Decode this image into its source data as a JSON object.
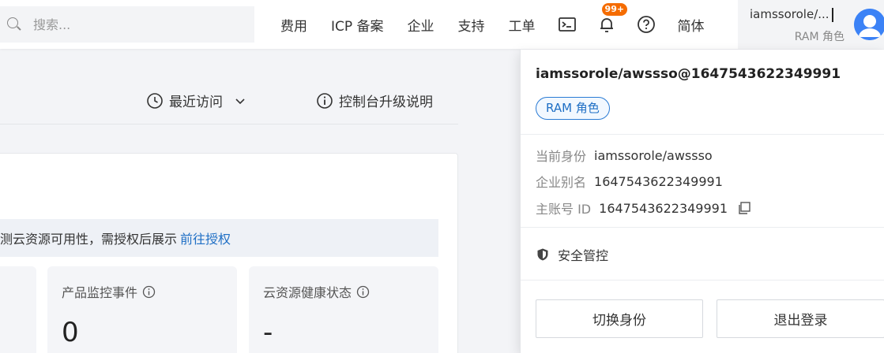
{
  "search": {
    "placeholder": "搜索..."
  },
  "nav": {
    "fees": "费用",
    "icp": "ICP 备案",
    "enterprise": "企业",
    "support": "支持",
    "tickets": "工单",
    "notification_badge": "99+",
    "language": "简体"
  },
  "account": {
    "name": "iamssorole/...",
    "role": "RAM 角色"
  },
  "subbar": {
    "recent": "最近访问",
    "upgrade": "控制台升级说明"
  },
  "notice": {
    "text": "测云资源可用性，需授权后展示",
    "link": "前往授权"
  },
  "stats": [
    {
      "title": "产品监控事件",
      "value": "0"
    },
    {
      "title": "云资源健康状态",
      "value": "-"
    }
  ],
  "panel": {
    "title": "iamssorole/awssso@1647543622349991",
    "role_tag": "RAM 角色",
    "current_identity_label": "当前身份",
    "current_identity_value": "iamssorole/awssso",
    "enterprise_alias_label": "企业别名",
    "enterprise_alias_value": "1647543622349991",
    "main_account_label": "主账号 ID",
    "main_account_value": "1647543622349991",
    "security": "安全管控",
    "switch_identity": "切换身份",
    "logout": "退出登录"
  }
}
